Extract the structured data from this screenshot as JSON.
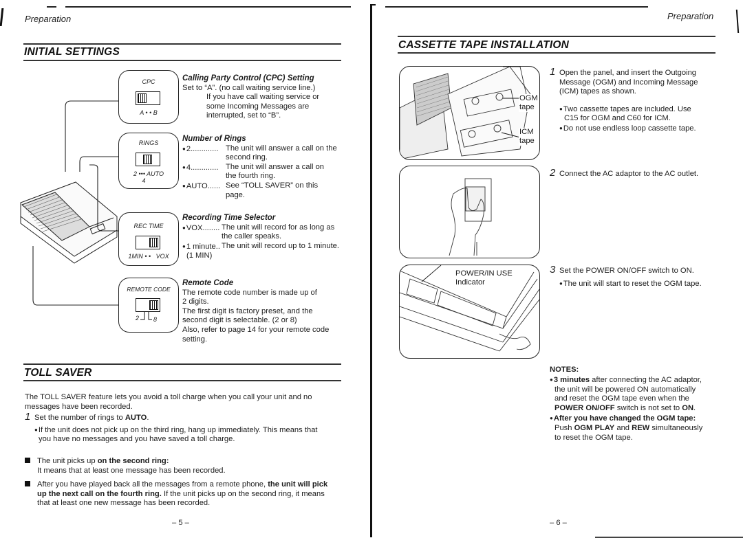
{
  "left_page": {
    "header": "Preparation",
    "initial_settings": {
      "title": "INITIAL SETTINGS",
      "switches": [
        {
          "panel_label": "CPC",
          "position_labels": "A • • B",
          "title": "Calling Party Control (CPC) Setting",
          "lines": [
            "Set to “A”. (no call waiting service line.)"
          ],
          "indented_lines": [
            "If you have call waiting service or",
            "some Incoming Messages are",
            "interrupted, set to “B”."
          ]
        },
        {
          "panel_label": "RINGS",
          "position_labels": "2 ••• AUTO",
          "position_sub_label": "4",
          "title": "Number of Rings",
          "options": [
            {
              "key": "2.............",
              "desc": [
                "The unit will answer a call on the",
                "second ring."
              ]
            },
            {
              "key": "4.............",
              "desc": [
                "The unit will answer a call on",
                "the fourth ring."
              ]
            },
            {
              "key": "AUTO......",
              "desc": [
                "See “TOLL SAVER” on this",
                "page."
              ]
            }
          ]
        },
        {
          "panel_label": "REC TIME",
          "position_labels": "1MIN • •   VOX",
          "title": "Recording Time Selector",
          "options": [
            {
              "key": "VOX........",
              "desc": [
                "The unit will record for as long as",
                "the caller speaks."
              ]
            },
            {
              "key": "1 minute..",
              "desc": [
                "The unit will record up to 1 minute."
              ]
            }
          ],
          "extra": "(1 MIN)"
        },
        {
          "panel_label": "REMOTE CODE",
          "position_left": "2",
          "position_right": "8",
          "title": "Remote Code",
          "lines": [
            "The remote code number is made up of",
            "2 digits.",
            "The first digit is factory preset, and the",
            "second digit is selectable. (2 or 8)",
            "Also, refer to page 14 for your remote code",
            "setting."
          ]
        }
      ]
    },
    "toll_saver": {
      "title": "TOLL SAVER",
      "intro": [
        "The TOLL SAVER feature lets you avoid a toll charge when you call your unit and no",
        "messages have been recorded."
      ],
      "step1": {
        "num": "1",
        "text_prefix": "Set the number of rings to ",
        "text_bold": "AUTO",
        "text_suffix": "."
      },
      "step1_bullet": [
        "If the unit does not pick up on the third ring, hang up immediately. This means that",
        "you have no messages and you have saved a toll charge."
      ],
      "items": [
        {
          "prefix": "The unit picks up ",
          "bold": "on the second ring:",
          "line2": "It means that at least one message has been recorded."
        },
        {
          "prefix": "After you have played back all the messages from a remote phone, ",
          "bold": "the unit will pick",
          "bold2": "up the next call on the fourth ring.",
          "rest2": " If the unit picks up on the second ring, it means",
          "line3": "that at least one new message has been recorded."
        }
      ]
    },
    "page_number": "– 5 –"
  },
  "right_page": {
    "header": "Preparation",
    "title": "CASSETTE TAPE INSTALLATION",
    "figure1_labels": {
      "ogm": [
        "OGM",
        "tape"
      ],
      "icm": [
        "ICM",
        "tape"
      ]
    },
    "figure3_labels": [
      "POWER/IN USE",
      "Indicator"
    ],
    "steps": [
      {
        "num": "1",
        "lines": [
          "Open the panel, and insert the Outgoing",
          "Message (OGM) and Incoming Message",
          "(ICM) tapes as shown."
        ],
        "bullets": [
          [
            "Two cassette tapes are included. Use",
            "C15 for OGM and C60  for  ICM."
          ],
          [
            "Do not use endless loop cassette tape."
          ]
        ]
      },
      {
        "num": "2",
        "lines": [
          "Connect the AC adaptor to the AC outlet."
        ]
      },
      {
        "num": "3",
        "lines": [
          "Set the POWER ON/OFF switch to ON."
        ],
        "bullets": [
          [
            "The unit will start to reset the OGM tape."
          ]
        ]
      }
    ],
    "notes": {
      "title": "NOTES:",
      "note1": {
        "bold": "3 minutes",
        "rest": " after connecting the AC adaptor,",
        "line2": "the unit will be powered ON automatically",
        "line3": "and reset the OGM tape even when the",
        "line4_bold1": "POWER ON/OFF",
        "line4_mid": " switch is not set to ",
        "line4_bold2": "ON",
        "line4_end": "."
      },
      "note2": {
        "bold": "After you have changed the OGM tape:",
        "line2_a": "Push ",
        "line2_b": "OGM PLAY",
        "line2_c": " and ",
        "line2_d": "REW",
        "line2_e": " simultaneously",
        "line3": "to reset the OGM tape."
      }
    },
    "page_number": "– 6 –"
  }
}
